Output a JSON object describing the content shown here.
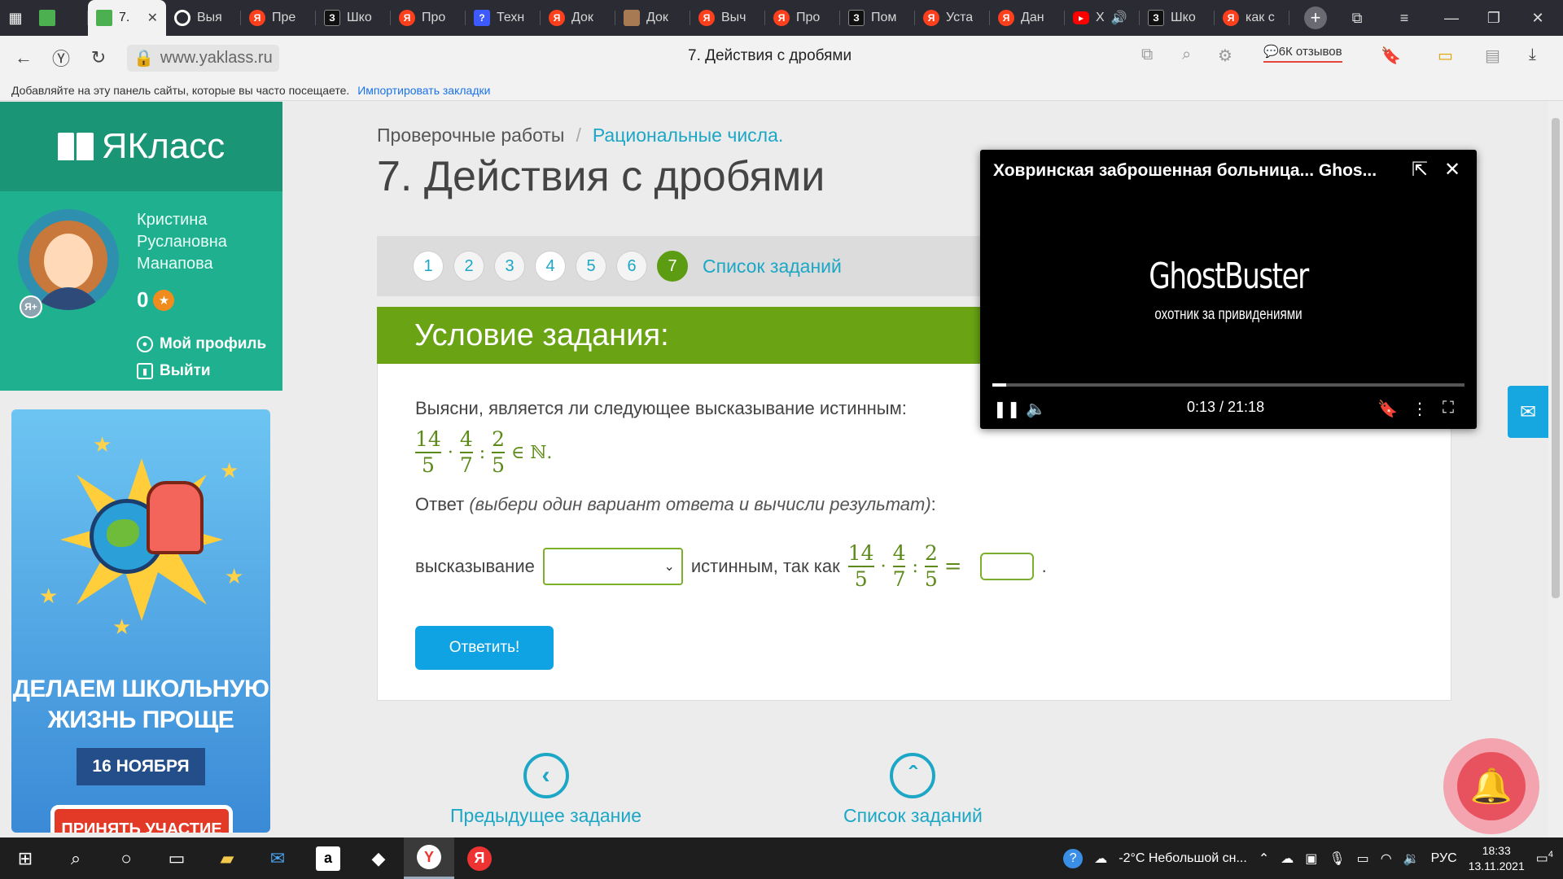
{
  "browser": {
    "tabs": [
      {
        "label": "",
        "icon": "klass-favicon"
      },
      {
        "label": "7.",
        "icon": "klass-favicon",
        "active": true
      },
      {
        "label": "Выя",
        "icon": "circle-favicon"
      },
      {
        "label": "Пре",
        "icon": "yandex-favicon"
      },
      {
        "label": "Шко",
        "icon": "z-favicon"
      },
      {
        "label": "Про",
        "icon": "yandex-favicon"
      },
      {
        "label": "Техн",
        "icon": "question-favicon"
      },
      {
        "label": "Док",
        "icon": "yandex-favicon"
      },
      {
        "label": "Док",
        "icon": "photo-favicon"
      },
      {
        "label": "Выч",
        "icon": "yandex-favicon"
      },
      {
        "label": "Про",
        "icon": "yandex-favicon"
      },
      {
        "label": "Пом",
        "icon": "z-favicon"
      },
      {
        "label": "Уста",
        "icon": "yandex-favicon"
      },
      {
        "label": "Дан",
        "icon": "yandex-favicon"
      },
      {
        "label": "Х",
        "icon": "youtube-favicon"
      },
      {
        "label": "Шко",
        "icon": "z-favicon"
      },
      {
        "label": "как с",
        "icon": "yandex-favicon"
      }
    ],
    "url": "www.yaklass.ru",
    "page_title": "7. Действия с дробями",
    "reviews": "6К отзывов",
    "bookmarks_hint": "Добавляйте на эту панель сайты, которые вы часто посещаете.",
    "bookmarks_import": "Импортировать закладки"
  },
  "sidebar": {
    "logo": "ЯКласс",
    "user_name": "Кристина Руслановна Манапова",
    "score": "0",
    "profile_link": "Мой профиль",
    "logout_link": "Выйти",
    "ad": {
      "title": "ДЕЛАЕМ ШКОЛЬНУЮ ЖИЗНЬ ПРОЩЕ",
      "date": "16 НОЯБРЯ",
      "cta": "ПРИНЯТЬ УЧАСТИЕ"
    }
  },
  "main": {
    "breadcrumb": {
      "first": "Проверочные работы",
      "separator": "/",
      "second": "Рациональные числа."
    },
    "title": "7. Действия с дробями",
    "steps": [
      "1",
      "2",
      "3",
      "4",
      "5",
      "6",
      "7"
    ],
    "current_step": "7",
    "task_list_link": "Список заданий",
    "task_header": "Условие задания:",
    "question": "Выясни, является ли следующее высказывание истинным:",
    "expression": {
      "f1_num": "14",
      "f1_den": "5",
      "op1": "·",
      "f2_num": "4",
      "f2_den": "7",
      "op2": ":",
      "f3_num": "2",
      "f3_den": "5",
      "tail": "∈ ℕ."
    },
    "answer_prefix": "Ответ",
    "answer_hint": "(выбери один вариант ответа и вычисли результат)",
    "answer_suffix": ":",
    "row_label": "высказывание",
    "row_middle": "истинным, так как",
    "equals": "=",
    "period": ".",
    "select_value": "",
    "submit_label": "Ответить!",
    "prev_task": "Предыдущее задание",
    "task_list": "Список заданий"
  },
  "video": {
    "title": "Ховринская заброшенная больница... Ghos...",
    "brand": "GhostBuster",
    "subtitle": "охотник за привидениями",
    "time": "0:13 / 21:18",
    "progress": 0.01
  },
  "taskbar": {
    "weather": "-2°C  Небольшой сн...",
    "lang": "РУС",
    "time": "18:33",
    "date": "13.11.2021",
    "notifications": "4"
  },
  "colors": {
    "brand_green": "#1fb08f",
    "task_green": "#6aa314",
    "link_blue": "#1ba7c5",
    "button_blue": "#10a3e3"
  }
}
